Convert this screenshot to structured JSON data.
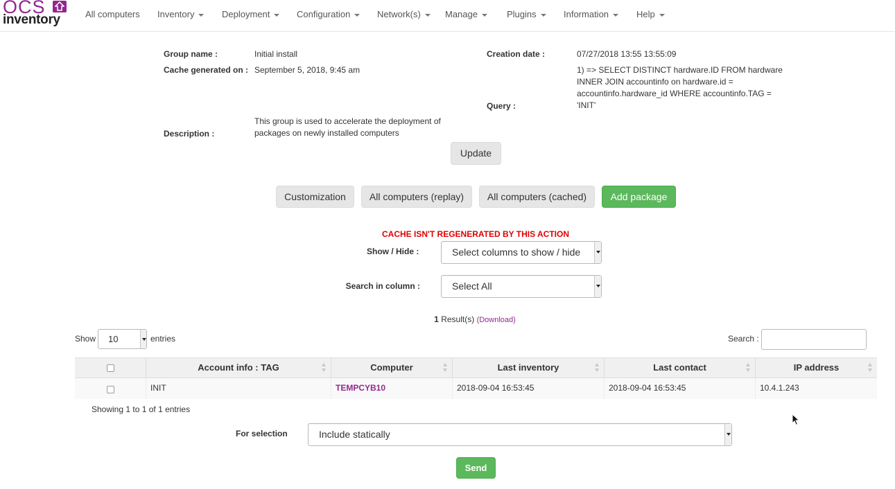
{
  "nav": {
    "logo_top": "OCS",
    "logo_bottom": "inventory",
    "items": [
      {
        "label": "All computers",
        "dropdown": false
      },
      {
        "label": "Inventory",
        "dropdown": true
      },
      {
        "label": "Deployment",
        "dropdown": true
      },
      {
        "label": "Configuration",
        "dropdown": true
      },
      {
        "label": "Network(s)",
        "dropdown": true
      },
      {
        "label": "Manage",
        "dropdown": true
      },
      {
        "label": "Plugins",
        "dropdown": true
      },
      {
        "label": "Information",
        "dropdown": true
      },
      {
        "label": "Help",
        "dropdown": true
      }
    ]
  },
  "group": {
    "name_label": "Group name :",
    "name_value": "Initial install",
    "cache_label": "Cache generated on :",
    "cache_value": "September 5, 2018, 9:45 am",
    "description_label": "Description :",
    "description_value": "This group is used to accelerate the deployment of packages on newly installed computers",
    "creation_label": "Creation date :",
    "creation_value": "07/27/2018 13:55 13:55:09",
    "query_label": "Query :",
    "query_value": "1) => SELECT DISTINCT hardware.ID FROM hardware INNER JOIN accountinfo on hardware.id = accountinfo.hardware_id WHERE accountinfo.TAG = 'INIT'",
    "update_label": "Update"
  },
  "actions": {
    "customization": "Customization",
    "replay": "All computers (replay)",
    "cached": "All computers (cached)",
    "add_package": "Add package"
  },
  "warning": "CACHE ISN'T REGENERATED BY THIS ACTION",
  "filters": {
    "show_hide_label": "Show / Hide :",
    "show_hide_value": "Select columns to show / hide",
    "search_col_label": "Search in column :",
    "search_col_value": "Select All"
  },
  "results": {
    "count": "1",
    "label": "Result(s)",
    "download": "(Download)"
  },
  "table_controls": {
    "show_label": "Show",
    "show_value": "10",
    "entries_label": "entries",
    "search_label": "Search :"
  },
  "table": {
    "columns": [
      "Account info : TAG",
      "Computer",
      "Last inventory",
      "Last contact",
      "IP address"
    ],
    "rows": [
      {
        "tag": "INIT",
        "computer": "TEMPCYB10",
        "last_inventory": "2018-09-04 16:53:45",
        "last_contact": "2018-09-04 16:53:45",
        "ip": "10.4.1.243"
      }
    ],
    "showing": "Showing 1 to 1 of 1 entries"
  },
  "selection": {
    "label": "For selection",
    "value": "Include statically",
    "send": "Send"
  },
  "colors": {
    "brand": "#93278f",
    "success": "#5cb85c",
    "warning": "#e00000"
  }
}
